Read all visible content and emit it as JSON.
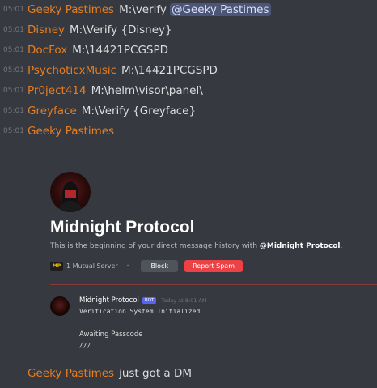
{
  "messages": [
    {
      "time": "05:01",
      "author": "Geeky Pastimes",
      "text": "M:\\verify",
      "mention": "@Geeky Pastimes"
    },
    {
      "time": "05:01",
      "author": "Disney",
      "text": "M:\\Verify {Disney}"
    },
    {
      "time": "05:01",
      "author": "DocFox",
      "text": "M:\\14421PCGSPD"
    },
    {
      "time": "05:01",
      "author": "PsychoticxMusic",
      "text": "M:\\14421PCGSPD"
    },
    {
      "time": "05:01",
      "author": "Pr0ject414",
      "text": "M:\\helm\\visor\\panel\\"
    },
    {
      "time": "05:01",
      "author": "Greyface",
      "text": "M:\\Verify {Greyface}"
    },
    {
      "time": "05:01",
      "author": "Geeky Pastimes",
      "text": ""
    }
  ],
  "embed": {
    "title": "Midnight Protocol",
    "subtitle_prefix": "This is the beginning of your direct message history with ",
    "subtitle_name": "@Midnight Protocol",
    "subtitle_suffix": ".",
    "server_icon_text": "MP",
    "mutual_servers": "1 Mutual Server",
    "separator": "•",
    "block_label": "Block",
    "report_label": "Report Spam",
    "bot_name": "Midnight Protocol",
    "bot_tag": "BOT",
    "bot_time": "Today at 8:01 AM",
    "line1": "Verification System Initialized",
    "line2": "Awaiting Passcode",
    "line3": "///"
  },
  "last_message": {
    "author": "Geeky Pastimes",
    "text": "just got a DM"
  },
  "colors": {
    "background": "#36393f",
    "author": "#e67e22",
    "mention_bg": "#4b5595",
    "report": "#ed4245",
    "block": "#4f545c",
    "bot_tag": "#5865f2"
  }
}
